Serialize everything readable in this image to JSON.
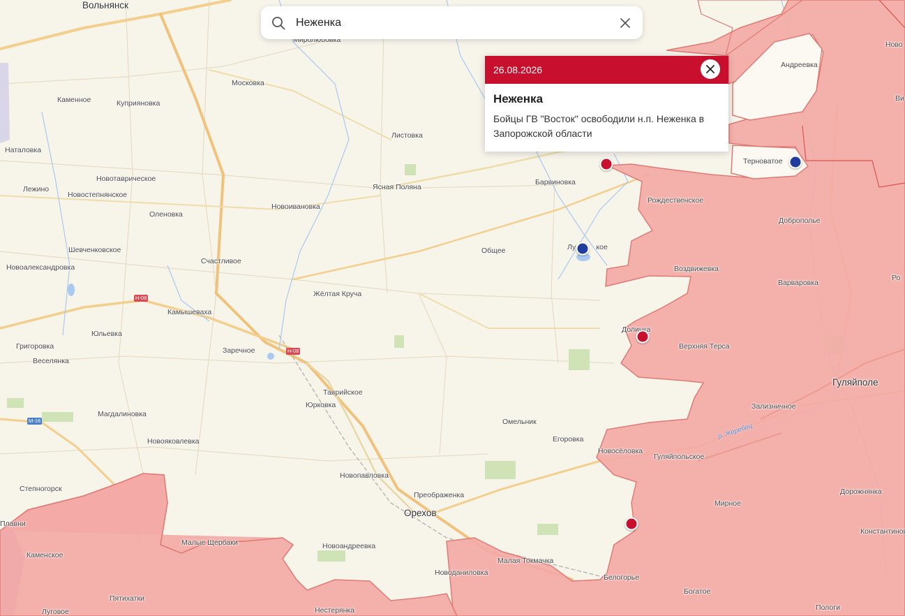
{
  "colors": {
    "occupied_fill": "#f3aaa6",
    "occupied_border": "#e07a74",
    "land": "#f7f4ea",
    "accent_red": "#c8102e",
    "marker_red": "#c8102e",
    "marker_blue": "#1f3c9e",
    "water": "#a9c9f0"
  },
  "search": {
    "query": "Неженка",
    "icon": "search-icon",
    "clear_icon": "close-icon"
  },
  "popup": {
    "date": "26.08.2026",
    "title": "Неженка",
    "text": "Бойцы ГВ \"Восток\" освободили н.п. Неженка в Запорожской области",
    "close_icon": "close-icon"
  },
  "places": {
    "volnyansk": "Вольнянск",
    "mirolyubovka": "Миролюбовка",
    "moskovka": "Московка",
    "kamennoe": "Каменное",
    "kupriyanovka": "Куприяновка",
    "listovka": "Листовка",
    "natalovka": "Наталовка",
    "novotavricheskoe": "Новотаврическое",
    "lezhino": "Лежино",
    "novostepnyanskoe": "Новостепнянское",
    "olenovka": "Оленовка",
    "yasnaya_polyana": "Ясная Поляна",
    "barvinovka": "Барвиновка",
    "novoivanovka": "Новоивановка",
    "shevchenkovskoe": "Шевченковское",
    "obshchee": "Общее",
    "luk_koe": "Лу          кое",
    "novoaleksandrovka": "Новоалександровка",
    "schastlivoe": "Счастливое",
    "zheltaya_krucha": "Жёлтая Круча",
    "kamyshevakha": "Камышеваха",
    "yulevka": "Юльевка",
    "grigorovka": "Григоровка",
    "veselyanka": "Веселянка",
    "zarechnoe": "Заречное",
    "dolinka": "Долинка",
    "tavricheskoe": "Таврийское",
    "yurkovka": "Юрковка",
    "magdalinovka": "Магдалиновка",
    "novoyakovlevka": "Новояковлевка",
    "omelnik": "Омельник",
    "egorovka": "Егоровка",
    "stepnogorsk": "Степногорск",
    "novopavlovka": "Новопавловка",
    "preobrazhenka": "Преображенка",
    "orekhov": "Орехов",
    "plavni": "Плавни",
    "malye_shcherbaki": "Малые Щербаки",
    "kamenskoe": "Каменское",
    "novoandreevka": "Новоандреевка",
    "malaya_tokmachka": "Малая Токмачка",
    "novodanilovka": "Новоданиловка",
    "pyatikhatki": "Пятихатки",
    "lugovoe": "Луговое",
    "nesteryanka": "Нестерянка",
    "andreevka": "Андреевка",
    "ternovatoe": "Терноватое",
    "rozhdestvenskoe": "Рождественское",
    "dobropolye": "Доброполье",
    "vozdvizhevka": "Воздвижевка",
    "varvarovka": "Варваровка",
    "verkhnyaya_tersa": "Верхняя Терса",
    "gulyaipole": "Гуляйполе",
    "zaliznichnoe": "Зализничное",
    "novoselovka": "Новосёловка",
    "gulyaipolskoe": "Гуляйпольское",
    "mirnoe": "Мирное",
    "dorozhnyanka": "Дорожнянка",
    "konstantinovka": "Константиновка",
    "belogorye": "Белогорье",
    "bogatoe": "Богатое",
    "pologi": "Пологи",
    "novo_edge": "Ново",
    "vi_edge": "Ви",
    "ro_edge": "Ро"
  },
  "river": "р. Жеребец",
  "roads": {
    "h08_a": "Н-08",
    "h08_b": "Н-08",
    "m18": "М-18"
  }
}
